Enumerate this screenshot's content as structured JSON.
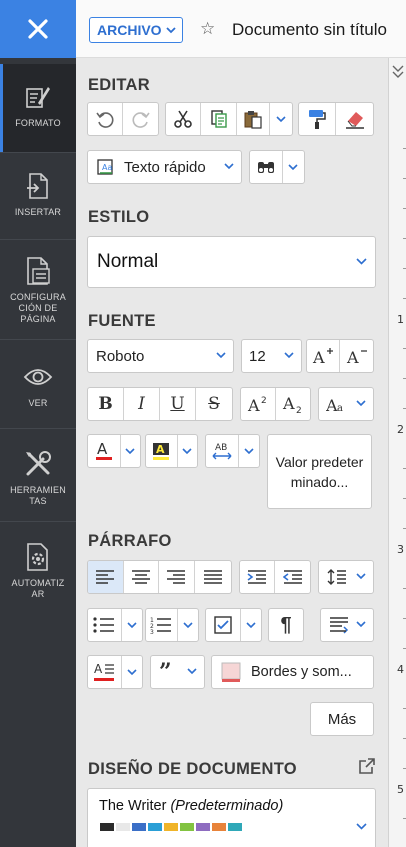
{
  "nav": {
    "items": [
      {
        "label": "FORMATO"
      },
      {
        "label": "INSERTAR"
      },
      {
        "label": "CONFIGURA CIÓN DE PÁGINA"
      },
      {
        "label": "VER"
      },
      {
        "label": "HERRAMIEN TAS"
      },
      {
        "label": "AUTOMATIZ AR"
      }
    ]
  },
  "header": {
    "archivo": "ARCHIVO",
    "title": "Documento sin título"
  },
  "sections": {
    "editar": "EDITAR",
    "estilo": "ESTILO",
    "fuente": "FUENTE",
    "parrafo": "PÁRRAFO",
    "diseno": "DISEÑO DE DOCUMENTO"
  },
  "editar": {
    "texto_rapido": "Texto rápido"
  },
  "estilo": {
    "selected": "Normal"
  },
  "fuente": {
    "family": "Roboto",
    "size": "12",
    "valor_predeterminado": "Valor predeterminado..."
  },
  "parrafo": {
    "bordes": "Bordes y som...",
    "mas": "Más"
  },
  "diseno": {
    "theme_name": "The Writer",
    "theme_tag": "(Predeterminado)",
    "palette": [
      "#2b2b2b",
      "#e8e8e8",
      "#3b6fc7",
      "#2a9fd6",
      "#f0b429",
      "#82c341",
      "#8e6cc0",
      "#e8833a",
      "#2fa8b8"
    ]
  },
  "ruler": {
    "numbers": [
      "1",
      "2",
      "3",
      "4",
      "5"
    ]
  },
  "colors": {
    "accent": "#3b82e3",
    "nav_bg": "#33363b",
    "panel_bg": "#e8e8e8"
  }
}
